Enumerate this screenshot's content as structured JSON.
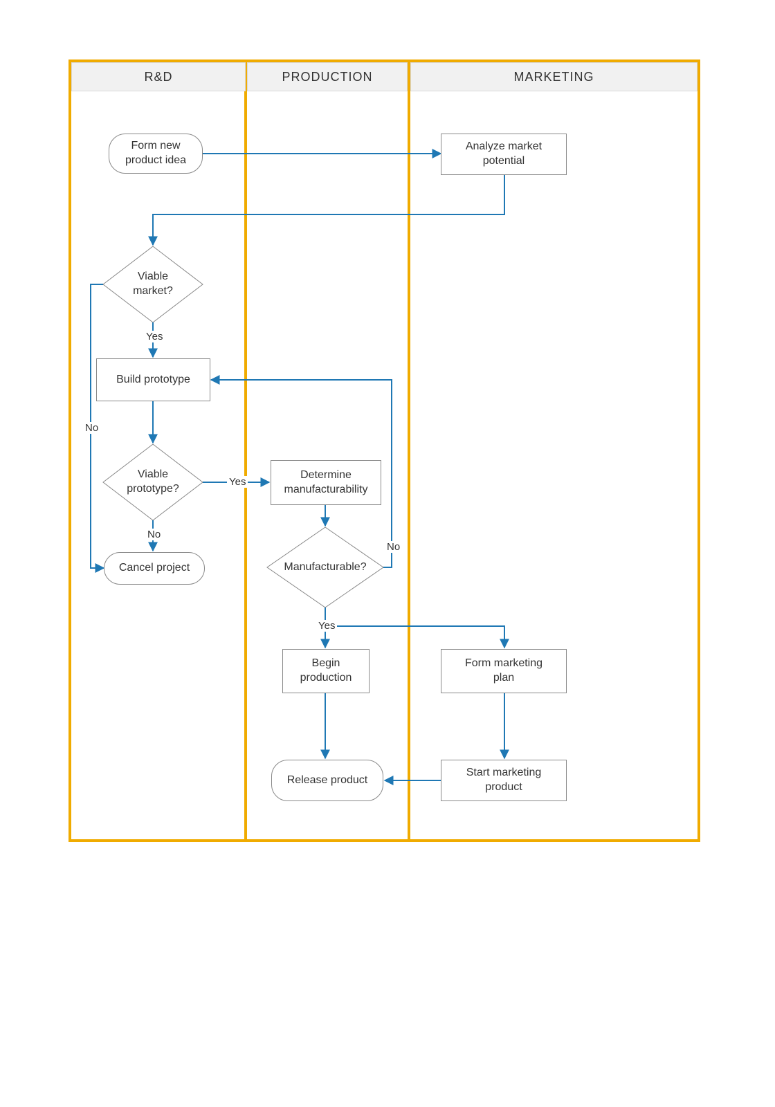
{
  "lanes": {
    "rd": "R&D",
    "production": "PRODUCTION",
    "marketing": "MARKETING"
  },
  "nodes": {
    "form_idea": "Form new\nproduct idea",
    "analyze_market": "Analyze market\npotential",
    "viable_market": "Viable\nmarket?",
    "build_prototype": "Build prototype",
    "viable_prototype": "Viable\nprototype?",
    "cancel_project": "Cancel project",
    "determine_manuf": "Determine\nmanufacturability",
    "manufacturable": "Manufacturable?",
    "begin_production": "Begin\nproduction",
    "form_marketing_plan": "Form marketing\nplan",
    "release_product": "Release product",
    "start_marketing_product": "Start marketing\nproduct"
  },
  "edge_labels": {
    "yes": "Yes",
    "no": "No"
  },
  "colors": {
    "lane_border": "#f0ab00",
    "connector": "#1f78b4",
    "node_border": "#888888"
  }
}
